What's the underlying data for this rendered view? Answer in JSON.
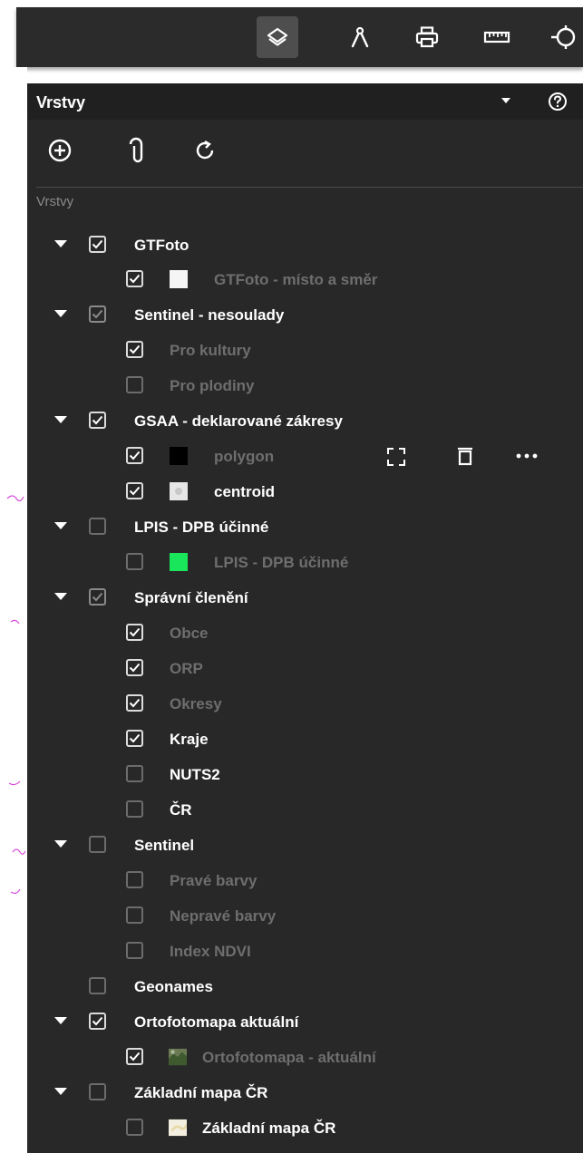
{
  "toolbar": {
    "tools": [
      {
        "name": "layers",
        "active": true
      },
      {
        "name": "measure-compass"
      },
      {
        "name": "print"
      },
      {
        "name": "ruler"
      },
      {
        "name": "crosshair"
      }
    ]
  },
  "panel": {
    "title": "Vrstvy",
    "section_label": "Vrstvy",
    "actions": [
      "add-circle-icon",
      "attachment-icon",
      "refresh-icon"
    ]
  },
  "tree": {
    "gtfoto": {
      "label": "GTFoto",
      "checked": true
    },
    "gtfoto_misto": {
      "label": "GTFoto - místo a směr",
      "checked": true,
      "swatch": "#f5f5f5"
    },
    "sentinel_nesoulady": {
      "label": "Sentinel - nesoulady",
      "checked": true
    },
    "pro_kultury": {
      "label": "Pro kultury",
      "checked": true
    },
    "pro_plodiny": {
      "label": "Pro plodiny",
      "checked": false
    },
    "gsaa": {
      "label": "GSAA - deklarované zákresy",
      "checked": true
    },
    "polygon": {
      "label": "polygon",
      "checked": true,
      "swatch": "#000000"
    },
    "centroid": {
      "label": "centroid",
      "checked": true,
      "swatch": "#e6e6e6"
    },
    "lpis": {
      "label": "LPIS - DPB účinné",
      "checked": false
    },
    "lpis_child": {
      "label": "LPIS - DPB účinné",
      "checked": false,
      "swatch": "#19e65a"
    },
    "spravni": {
      "label": "Správní členění",
      "checked": true
    },
    "obce": {
      "label": "Obce",
      "checked": true
    },
    "orp": {
      "label": "ORP",
      "checked": true
    },
    "okresy": {
      "label": "Okresy",
      "checked": true
    },
    "kraje": {
      "label": "Kraje",
      "checked": true
    },
    "nuts2": {
      "label": "NUTS2",
      "checked": false
    },
    "cr": {
      "label": "ČR",
      "checked": false
    },
    "sentinel": {
      "label": "Sentinel",
      "checked": false
    },
    "prave_barvy": {
      "label": "Pravé barvy",
      "checked": false
    },
    "neprave_barvy": {
      "label": "Nepravé barvy",
      "checked": false
    },
    "index_ndvi": {
      "label": "Index NDVI",
      "checked": false
    },
    "geonames": {
      "label": "Geonames",
      "checked": false
    },
    "orto": {
      "label": "Ortofotomapa aktuální",
      "checked": true
    },
    "orto_child": {
      "label": "Ortofotomapa - aktuální",
      "checked": true
    },
    "zakladni": {
      "label": "Základní mapa ČR",
      "checked": false
    },
    "zakladni_child": {
      "label": "Základní mapa ČR",
      "checked": false
    }
  },
  "colors": {
    "panel_bg": "#282828",
    "header_bg": "#202020",
    "toolbar_bg": "#2b2b2b",
    "active_tool_bg": "#4e4e4e",
    "text": "#ffffff",
    "text_dim": "#6e6e6e",
    "map_marks": "#d44bd8"
  }
}
